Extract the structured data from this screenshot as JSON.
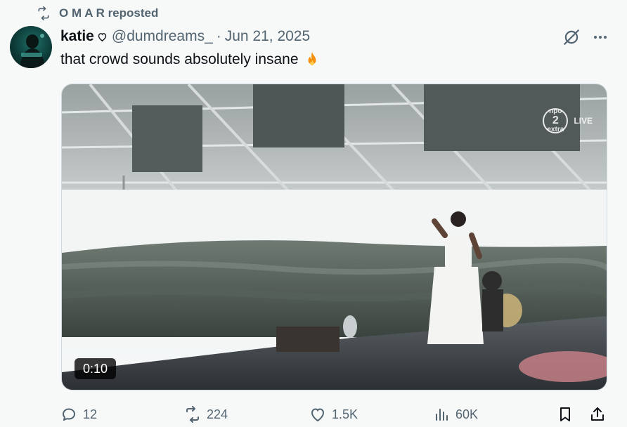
{
  "repost": {
    "label": "O M A R reposted",
    "icon": "repost-icon"
  },
  "author": {
    "name": "katie",
    "badge_icon": "heart-outline-icon",
    "handle": "@dumdreams_",
    "separator": "·",
    "date": "Jun 21, 2025"
  },
  "post": {
    "text": "that crowd sounds absolutely insane",
    "emoji_icon": "fire-emoji-icon"
  },
  "media": {
    "duration": "0:10",
    "watermark": {
      "brand": "npo",
      "channel": "2",
      "sub": "extra",
      "live": "LIVE"
    }
  },
  "actions": {
    "replies": "12",
    "reposts": "224",
    "likes": "1.5K",
    "views": "60K"
  },
  "colors": {
    "text": "#0f1419",
    "secondary": "#536471",
    "background": "#f7f9f9",
    "grok": "#536471"
  }
}
